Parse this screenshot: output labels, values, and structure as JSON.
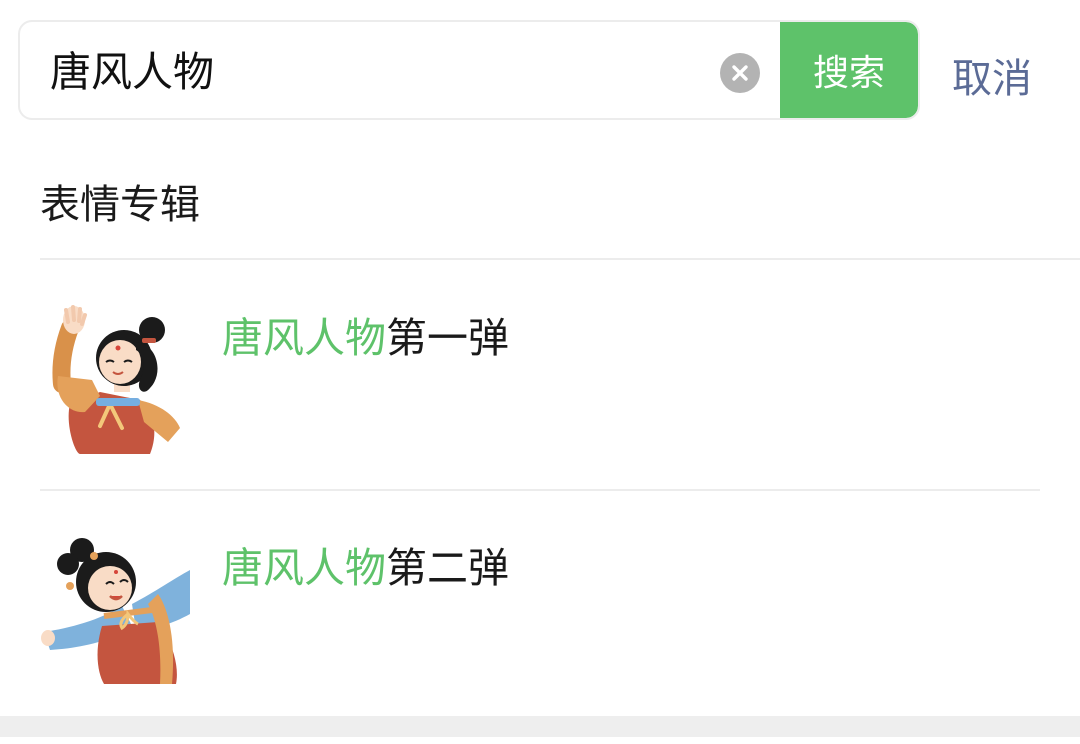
{
  "search": {
    "query": "唐风人物",
    "search_label": "搜索",
    "cancel_label": "取消",
    "clear_icon": "clear-icon"
  },
  "section": {
    "title": "表情专辑"
  },
  "results": [
    {
      "highlight": "唐风人物",
      "suffix": "第一弹",
      "icon": "tang-lady-waving"
    },
    {
      "highlight": "唐风人物",
      "suffix": "第二弹",
      "icon": "tang-lady-dancing"
    }
  ],
  "colors": {
    "accent": "#5ec26a",
    "cancel": "#5b6b96",
    "divider": "#ececec"
  }
}
